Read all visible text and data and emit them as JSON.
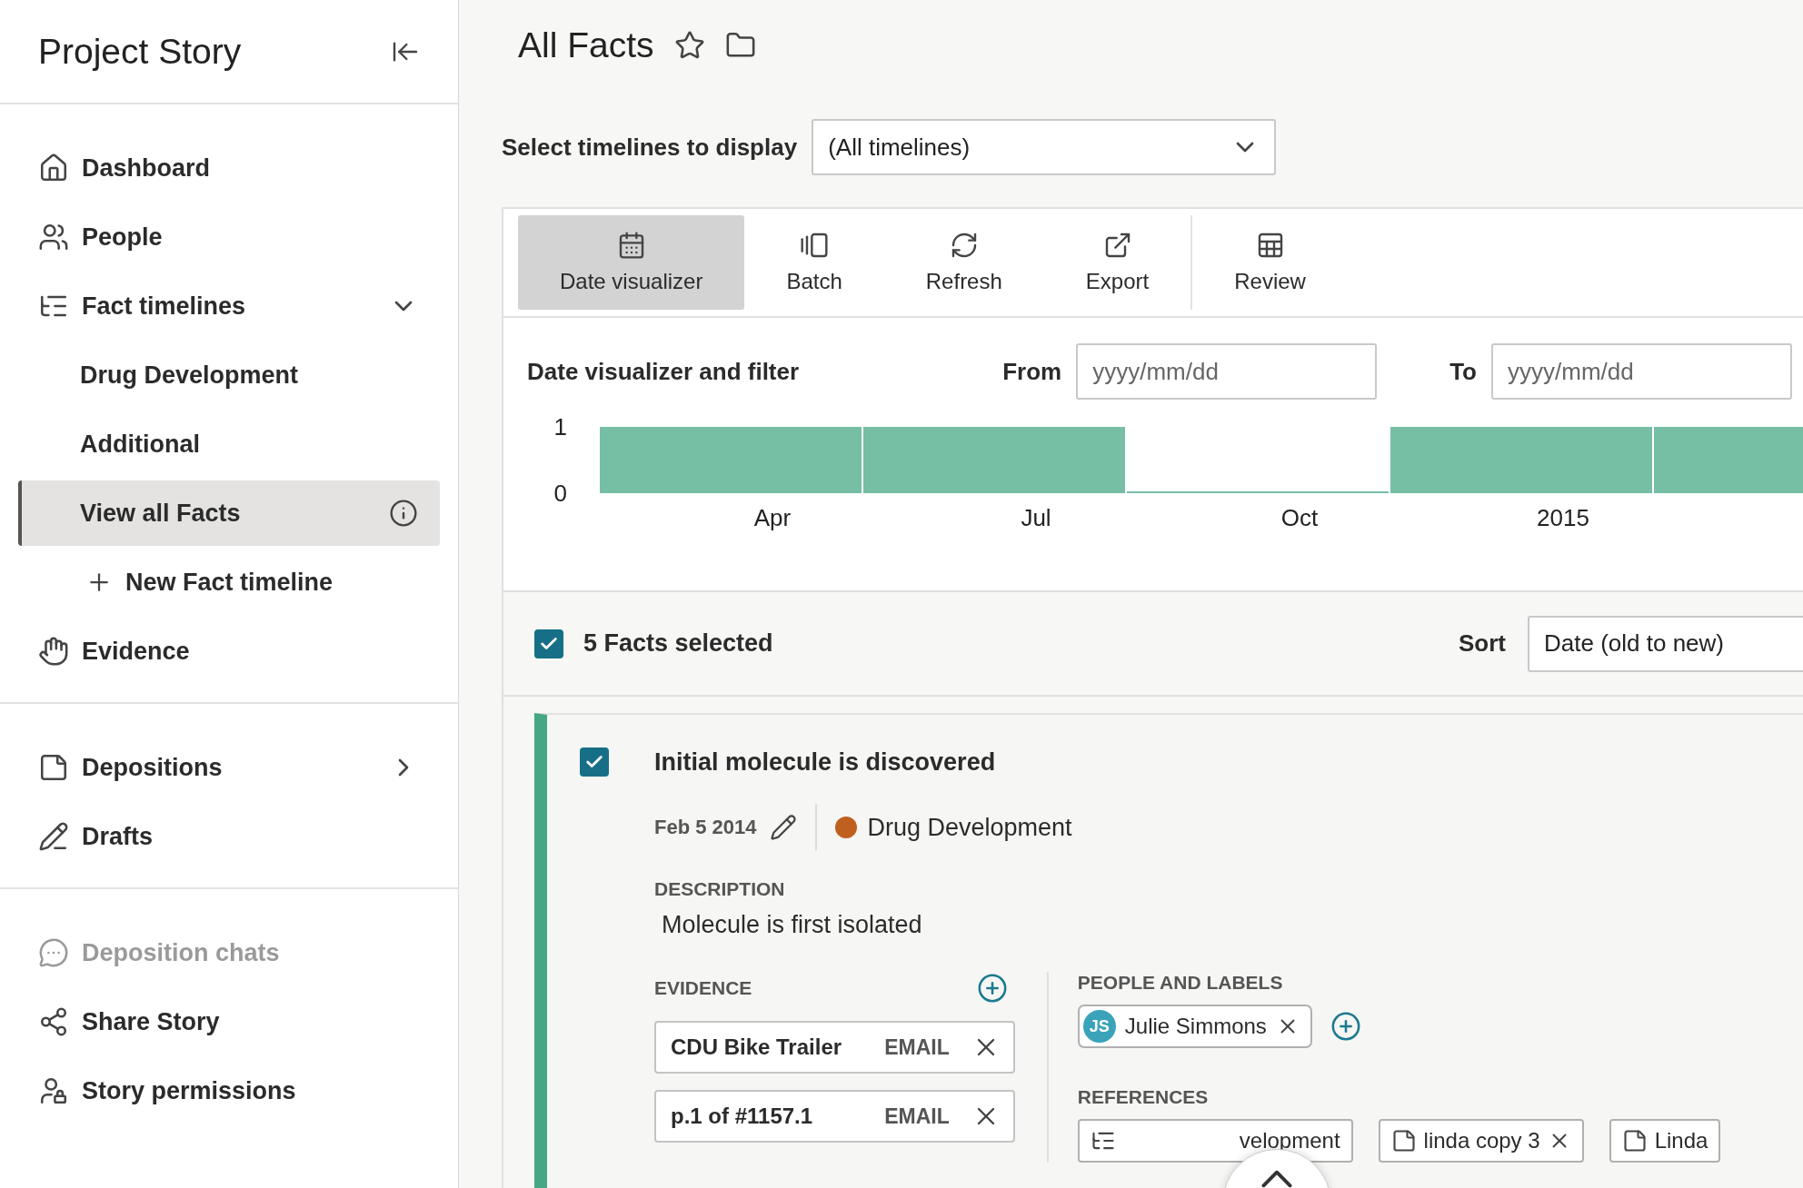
{
  "sidebar": {
    "title": "Project Story",
    "sections": [
      {
        "items": [
          {
            "label": "Dashboard",
            "selected": false,
            "disabled": false
          },
          {
            "label": "People",
            "selected": false,
            "disabled": false
          },
          {
            "label": "Fact timelines",
            "selected": false,
            "disabled": false,
            "expanded": true,
            "children": [
              {
                "kind": "link",
                "label": "Drug Development",
                "selected": false
              },
              {
                "kind": "link",
                "label": "Additional",
                "selected": false
              },
              {
                "kind": "link",
                "label": "View all Facts",
                "selected": true
              },
              {
                "kind": "add",
                "label": "New Fact timeline",
                "selected": false
              }
            ]
          },
          {
            "label": "Evidence",
            "selected": false,
            "disabled": false
          }
        ]
      },
      {
        "items": [
          {
            "label": "Depositions",
            "selected": false,
            "disabled": false,
            "expanded": false
          },
          {
            "label": "Drafts",
            "selected": false,
            "disabled": false
          }
        ]
      },
      {
        "items": [
          {
            "label": "Deposition chats",
            "selected": false,
            "disabled": true
          },
          {
            "label": "Share Story",
            "selected": false,
            "disabled": false
          },
          {
            "label": "Story permissions",
            "selected": false,
            "disabled": false
          }
        ]
      }
    ]
  },
  "page": {
    "title": "All Facts"
  },
  "timeline_select": {
    "label": "Select timelines to display",
    "value": "(All timelines)"
  },
  "toolbar": {
    "groups": [
      [
        {
          "label": "Date visualizer",
          "selected": true
        },
        {
          "label": "Batch",
          "selected": false
        },
        {
          "label": "Refresh",
          "selected": false
        },
        {
          "label": "Export",
          "selected": false
        }
      ],
      [
        {
          "label": "Review",
          "selected": false
        }
      ]
    ]
  },
  "date_filter": {
    "title": "Date visualizer and filter",
    "from": {
      "label": "From",
      "placeholder": "yyyy/mm/dd"
    },
    "to": {
      "label": "To",
      "placeholder": "yyyy/mm/dd"
    },
    "chart_data": {
      "type": "bar",
      "categories": [
        "Apr",
        "Jul",
        "Oct",
        "2015",
        null
      ],
      "values": [
        1,
        1,
        0,
        1,
        1
      ],
      "ylim": [
        0,
        1
      ],
      "yticks": [
        0,
        1
      ]
    }
  },
  "selection": {
    "label": "5 Facts selected",
    "checked": true,
    "sort": {
      "label": "Sort",
      "value": "Date (old to new)"
    }
  },
  "facts": [
    {
      "checked": true,
      "title": "Initial molecule is discovered",
      "date": "Feb 5 2014",
      "timeline": {
        "label": "Drug Development",
        "color": "#c0601f"
      },
      "description_label": "DESCRIPTION",
      "description": "Molecule is first isolated",
      "evidence_label": "EVIDENCE",
      "evidence": [
        {
          "name": "CDU Bike Trailer",
          "type": "EMAIL"
        },
        {
          "name": "p.1 of #1157.1",
          "type": "EMAIL"
        }
      ],
      "people_label": "PEOPLE AND LABELS",
      "people": [
        {
          "initials": "JS",
          "name": "Julie Simmons"
        }
      ],
      "references_label": "REFERENCES",
      "references": [
        {
          "kind": "timeline",
          "label": "velopment",
          "removable": false,
          "covered": true
        },
        {
          "kind": "deposition",
          "label": "linda copy 3",
          "removable": true,
          "covered": false
        },
        {
          "kind": "deposition",
          "label": "Linda",
          "removable": false,
          "covered": false
        }
      ]
    }
  ]
}
